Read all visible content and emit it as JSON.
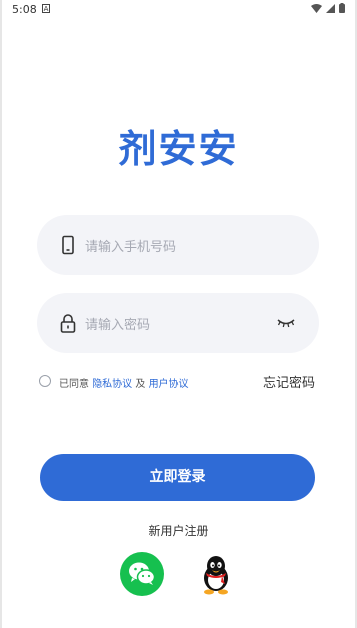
{
  "status_bar": {
    "time": "5:08",
    "badge": "A"
  },
  "app": {
    "title": "剂安安"
  },
  "phone_field": {
    "placeholder": "请输入手机号码"
  },
  "password_field": {
    "placeholder": "请输入密码"
  },
  "agreement": {
    "prefix": "已同意",
    "privacy_link": "隐私协议",
    "connector": "及",
    "user_link": "用户协议"
  },
  "forgot_password": "忘记密码",
  "login_button": "立即登录",
  "register_link": "新用户注册",
  "colors": {
    "accent": "#2f6bd6",
    "wechat": "#16c04f",
    "field_bg": "#f3f4f8"
  },
  "icons": [
    "wifi-icon",
    "signal-icon",
    "battery-icon",
    "phone-icon",
    "lock-icon",
    "eye-closed-icon",
    "wechat-icon",
    "qq-icon"
  ]
}
